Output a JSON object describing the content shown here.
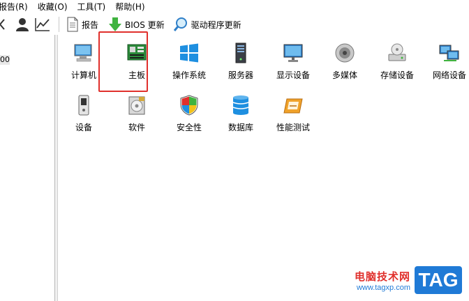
{
  "menu": [
    {
      "label": "报告(R)"
    },
    {
      "label": "收藏(O)"
    },
    {
      "label": "工具(T)"
    },
    {
      "label": "帮助(H)"
    }
  ],
  "toolbar": {
    "report": "报告",
    "bios_update": "BIOS 更新",
    "driver_update": "驱动程序更新"
  },
  "left_panel": {
    "tree_partial": "00"
  },
  "categories": [
    {
      "label": "计算机",
      "icon": "computer-icon"
    },
    {
      "label": "主板",
      "icon": "motherboard-icon"
    },
    {
      "label": "操作系统",
      "icon": "windows-icon"
    },
    {
      "label": "服务器",
      "icon": "server-icon"
    },
    {
      "label": "显示设备",
      "icon": "monitor-icon"
    },
    {
      "label": "多媒体",
      "icon": "speaker-icon"
    },
    {
      "label": "存储设备",
      "icon": "storage-icon"
    },
    {
      "label": "网络设备",
      "icon": "network-icon"
    },
    {
      "label": "设备",
      "icon": "device-icon"
    },
    {
      "label": "软件",
      "icon": "software-icon"
    },
    {
      "label": "安全性",
      "icon": "security-shield-icon"
    },
    {
      "label": "数据库",
      "icon": "database-icon"
    },
    {
      "label": "性能测试",
      "icon": "benchmark-icon"
    }
  ],
  "watermark": {
    "title": "电脑技术网",
    "url": "www.tagxp.com",
    "badge": "TAG"
  },
  "colors": {
    "highlight": "#e0302c",
    "accent_blue": "#1f7ad6"
  }
}
